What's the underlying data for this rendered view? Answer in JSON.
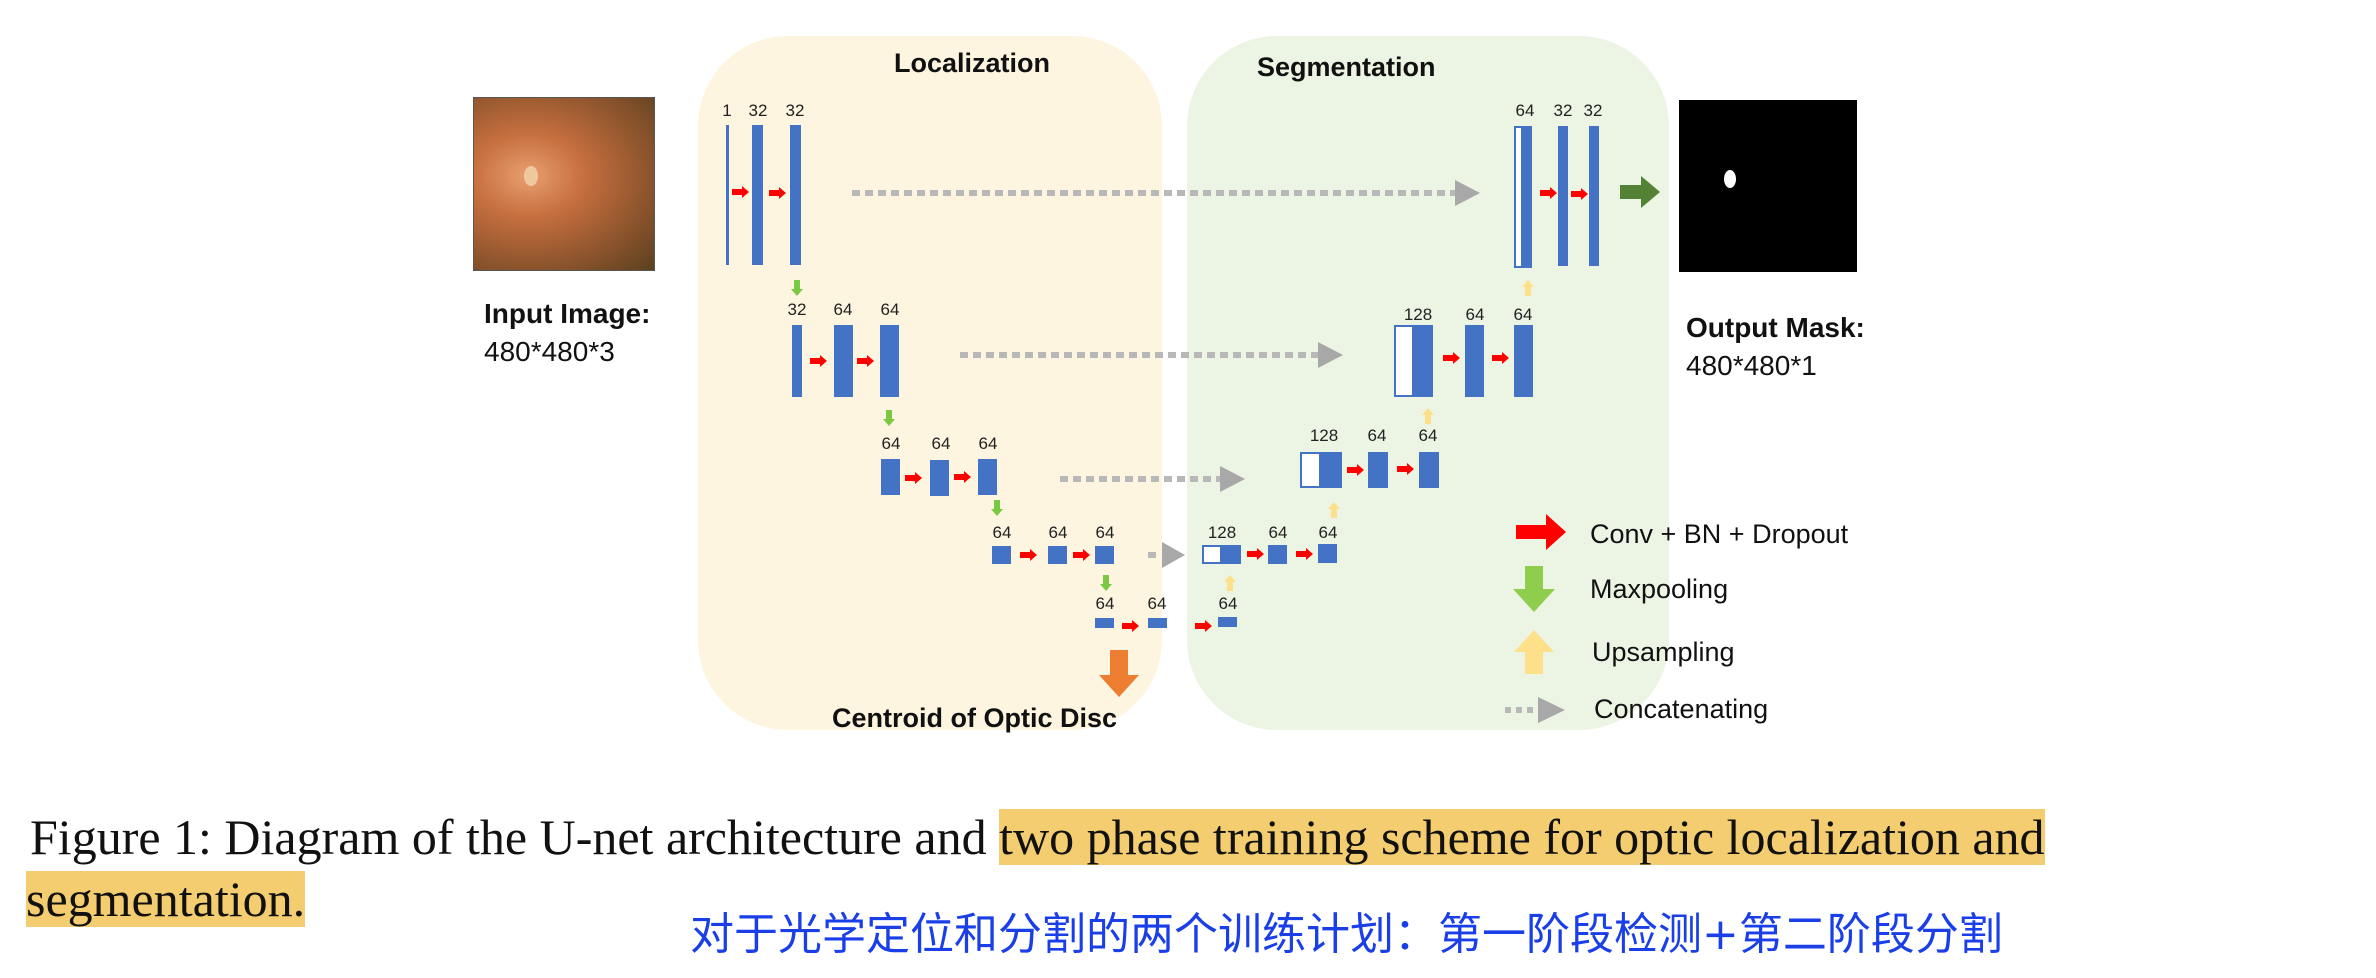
{
  "panels": {
    "localization": "Localization",
    "segmentation": "Segmentation",
    "centroid": "Centroid of Optic Disc"
  },
  "input": {
    "label": "Input Image:",
    "size": "480*480*3"
  },
  "output": {
    "label": "Output Mask:",
    "size": "480*480*1"
  },
  "encoder": {
    "level1": [
      "1",
      "32",
      "32"
    ],
    "level2": [
      "32",
      "64",
      "64"
    ],
    "level3": [
      "64",
      "64",
      "64"
    ],
    "level4": [
      "64",
      "64",
      "64"
    ],
    "bottleneck": [
      "64",
      "64",
      "64"
    ]
  },
  "decoder": {
    "level4": [
      "128",
      "64",
      "64"
    ],
    "level3": [
      "128",
      "64",
      "64"
    ],
    "level2": [
      "128",
      "64",
      "64"
    ],
    "level1": [
      "64",
      "32",
      "32"
    ]
  },
  "legend": [
    {
      "icon": "red-right-arrow-icon",
      "label": "Conv + BN + Dropout",
      "color": "#ff0000"
    },
    {
      "icon": "green-down-arrow-icon",
      "label": "Maxpooling",
      "color": "#7ac943"
    },
    {
      "icon": "yellow-up-arrow-icon",
      "label": "Upsampling",
      "color": "#ffe08a"
    },
    {
      "icon": "gray-dotted-arrow-icon",
      "label": "Concatenating",
      "color": "#a8a8a8"
    }
  ],
  "colors": {
    "block": "#4472c4",
    "conv": "#ff0000",
    "pool": "#7ac943",
    "up": "#ffe08a",
    "concat": "#a8a8a8",
    "output_arrow": "#548235",
    "centroid_arrow": "#ed7d31"
  },
  "caption": {
    "plain": "Figure 1: Diagram of the U-net architecture and ",
    "highlight1": "two phase training scheme for optic localization and",
    "highlight2": "segmentation.",
    "translation": "对于光学定位和分割的两个训练计划：第一阶段检测+第二阶段分割"
  }
}
